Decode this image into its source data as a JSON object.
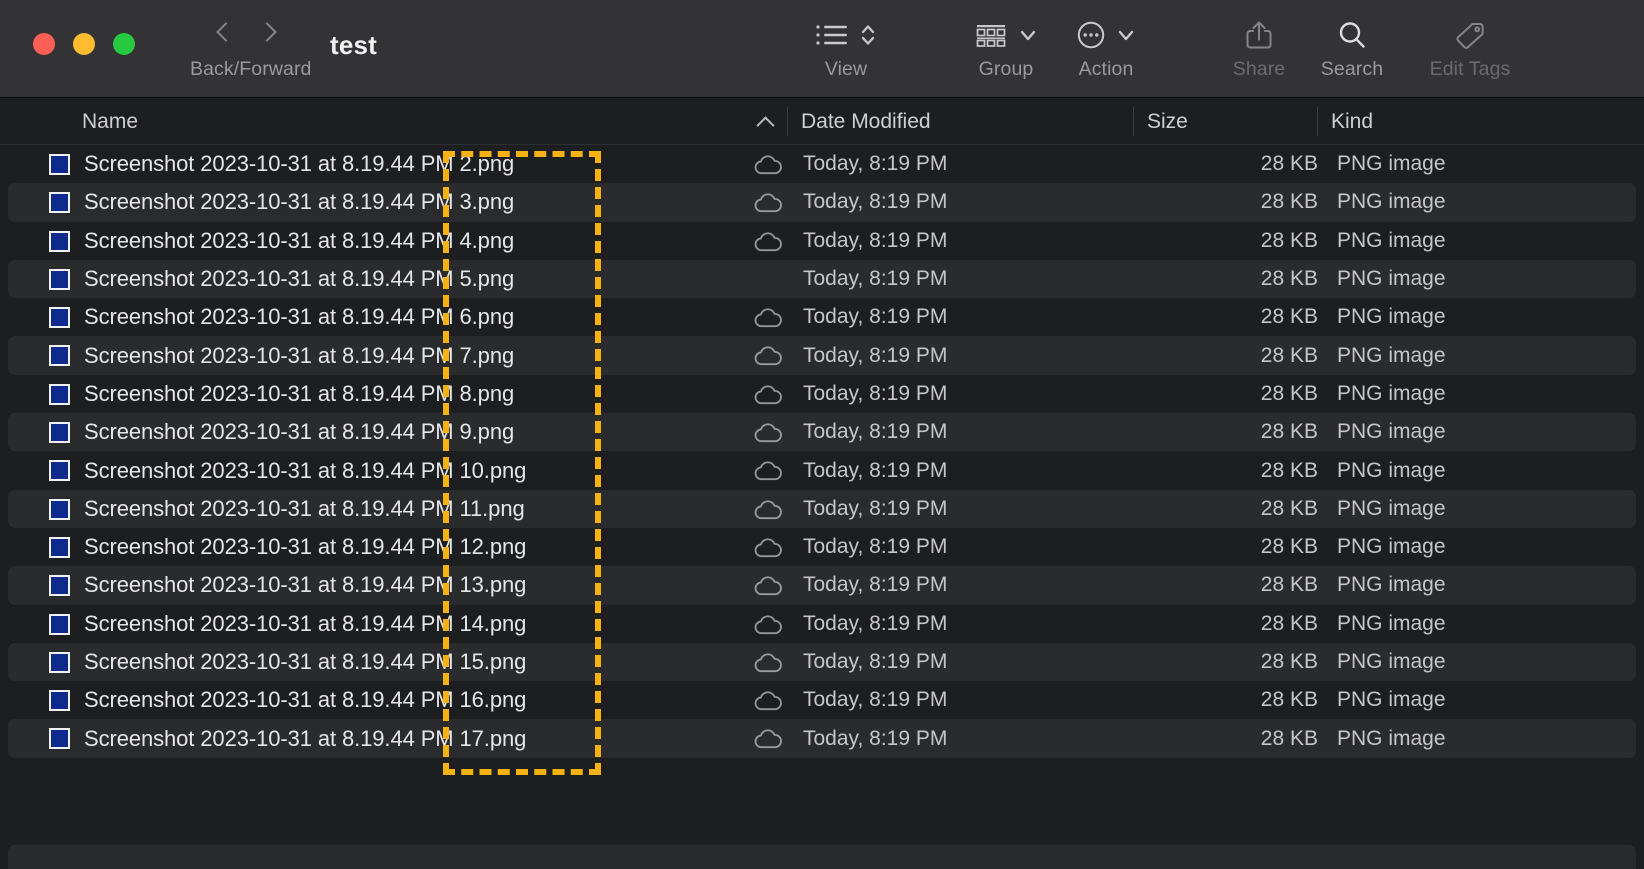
{
  "window": {
    "title": "test",
    "traffic_lights": [
      "close",
      "minimize",
      "zoom"
    ]
  },
  "toolbar": {
    "back_forward_label": "Back/Forward",
    "view_label": "View",
    "group_label": "Group",
    "action_label": "Action",
    "share_label": "Share",
    "search_label": "Search",
    "edit_tags_label": "Edit Tags"
  },
  "columns": {
    "name": "Name",
    "date_modified": "Date Modified",
    "size": "Size",
    "kind": "Kind",
    "sort_direction": "ascending",
    "sort_column": "Name"
  },
  "highlight": {
    "color": "#f5b212",
    "style": "dashed-rectangle"
  },
  "files": [
    {
      "name": "Screenshot 2023-10-31 at 8.19.44 PM 2.png",
      "date": "Today, 8:19 PM",
      "size": "28 KB",
      "kind": "PNG image",
      "cloud": true
    },
    {
      "name": "Screenshot 2023-10-31 at 8.19.44 PM 3.png",
      "date": "Today, 8:19 PM",
      "size": "28 KB",
      "kind": "PNG image",
      "cloud": true
    },
    {
      "name": "Screenshot 2023-10-31 at 8.19.44 PM 4.png",
      "date": "Today, 8:19 PM",
      "size": "28 KB",
      "kind": "PNG image",
      "cloud": true
    },
    {
      "name": "Screenshot 2023-10-31 at 8.19.44 PM 5.png",
      "date": "Today, 8:19 PM",
      "size": "28 KB",
      "kind": "PNG image",
      "cloud": false
    },
    {
      "name": "Screenshot 2023-10-31 at 8.19.44 PM 6.png",
      "date": "Today, 8:19 PM",
      "size": "28 KB",
      "kind": "PNG image",
      "cloud": true
    },
    {
      "name": "Screenshot 2023-10-31 at 8.19.44 PM 7.png",
      "date": "Today, 8:19 PM",
      "size": "28 KB",
      "kind": "PNG image",
      "cloud": true
    },
    {
      "name": "Screenshot 2023-10-31 at 8.19.44 PM 8.png",
      "date": "Today, 8:19 PM",
      "size": "28 KB",
      "kind": "PNG image",
      "cloud": true
    },
    {
      "name": "Screenshot 2023-10-31 at 8.19.44 PM 9.png",
      "date": "Today, 8:19 PM",
      "size": "28 KB",
      "kind": "PNG image",
      "cloud": true
    },
    {
      "name": "Screenshot 2023-10-31 at 8.19.44 PM 10.png",
      "date": "Today, 8:19 PM",
      "size": "28 KB",
      "kind": "PNG image",
      "cloud": true
    },
    {
      "name": "Screenshot 2023-10-31 at 8.19.44 PM 11.png",
      "date": "Today, 8:19 PM",
      "size": "28 KB",
      "kind": "PNG image",
      "cloud": true
    },
    {
      "name": "Screenshot 2023-10-31 at 8.19.44 PM 12.png",
      "date": "Today, 8:19 PM",
      "size": "28 KB",
      "kind": "PNG image",
      "cloud": true
    },
    {
      "name": "Screenshot 2023-10-31 at 8.19.44 PM 13.png",
      "date": "Today, 8:19 PM",
      "size": "28 KB",
      "kind": "PNG image",
      "cloud": true
    },
    {
      "name": "Screenshot 2023-10-31 at 8.19.44 PM 14.png",
      "date": "Today, 8:19 PM",
      "size": "28 KB",
      "kind": "PNG image",
      "cloud": true
    },
    {
      "name": "Screenshot 2023-10-31 at 8.19.44 PM 15.png",
      "date": "Today, 8:19 PM",
      "size": "28 KB",
      "kind": "PNG image",
      "cloud": true
    },
    {
      "name": "Screenshot 2023-10-31 at 8.19.44 PM 16.png",
      "date": "Today, 8:19 PM",
      "size": "28 KB",
      "kind": "PNG image",
      "cloud": true
    },
    {
      "name": "Screenshot 2023-10-31 at 8.19.44 PM 17.png",
      "date": "Today, 8:19 PM",
      "size": "28 KB",
      "kind": "PNG image",
      "cloud": true
    }
  ]
}
